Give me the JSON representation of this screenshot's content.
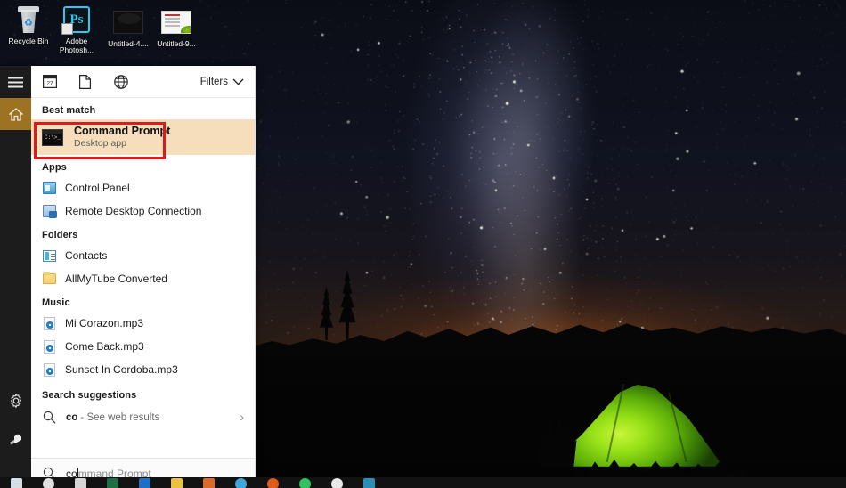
{
  "desktop": {
    "icons": [
      {
        "name": "recycle-bin",
        "label": "Recycle Bin"
      },
      {
        "name": "adobe-photoshop",
        "label": "Adobe Photosh...",
        "badge": "Ps"
      },
      {
        "name": "untitled-4",
        "label": "Untitled-4...."
      },
      {
        "name": "untitled-9",
        "label": "Untitled-9..."
      }
    ]
  },
  "start_panel": {
    "rail": {
      "items": [
        {
          "name": "hamburger-menu",
          "icon": "hamburger-icon",
          "active": false
        },
        {
          "name": "home",
          "icon": "home-icon",
          "active": true
        },
        {
          "name": "settings",
          "icon": "gear-icon",
          "active": false
        },
        {
          "name": "power",
          "icon": "power-icon",
          "active": false
        }
      ],
      "active_color": "#9d7323",
      "background": "#1c1c1c"
    },
    "toolbar": {
      "icons": [
        {
          "name": "apps-icon",
          "title": "Apps"
        },
        {
          "name": "documents-icon",
          "title": "Documents"
        },
        {
          "name": "web-icon",
          "title": "Web"
        }
      ],
      "filters_label": "Filters"
    },
    "sections": [
      {
        "heading": "Best match",
        "type": "best",
        "item": {
          "title": "Command Prompt",
          "subtitle": "Desktop app",
          "icon": "command-prompt-icon",
          "highlight_color": "#f6ddbc",
          "annotation_color": "#e3181b"
        }
      },
      {
        "heading": "Apps",
        "type": "list",
        "items": [
          {
            "label": "Control Panel",
            "icon": "control-panel-icon"
          },
          {
            "label": "Remote Desktop Connection",
            "icon": "remote-desktop-icon"
          }
        ]
      },
      {
        "heading": "Folders",
        "type": "list",
        "items": [
          {
            "label": "Contacts",
            "icon": "contacts-icon"
          },
          {
            "label": "AllMyTube Converted",
            "icon": "folder-icon"
          }
        ]
      },
      {
        "heading": "Music",
        "type": "list",
        "items": [
          {
            "label": "Mi Corazon.mp3",
            "icon": "music-file-icon"
          },
          {
            "label": "Come Back.mp3",
            "icon": "music-file-icon"
          },
          {
            "label": "Sunset In Cordoba.mp3",
            "icon": "music-file-icon"
          }
        ]
      },
      {
        "heading": "Search suggestions",
        "type": "suggestion",
        "item": {
          "query": "co",
          "rest": "- See web results",
          "icon": "search-icon",
          "chevron": "›"
        }
      }
    ],
    "search_box": {
      "icon": "search-icon",
      "typed_text": "co",
      "suggestion_text": "mmand Prompt",
      "full_value": "command Prompt"
    }
  },
  "taskbar": {
    "items": [
      {
        "name": "start-button",
        "color": "#d8dde3"
      },
      {
        "name": "search-button",
        "color": "#e0e0e0"
      },
      {
        "name": "task-view-button",
        "color": "#d6d6d6"
      },
      {
        "name": "excel-app",
        "color": "#1d7044"
      },
      {
        "name": "store-app",
        "color": "#1f6fc4"
      },
      {
        "name": "file-explorer-app",
        "color": "#ecc13c"
      },
      {
        "name": "paint-app",
        "color": "#d96a2b"
      },
      {
        "name": "edge-app",
        "color": "#3ea7dd"
      },
      {
        "name": "firefox-app",
        "color": "#e05a1a"
      },
      {
        "name": "whatsapp-app",
        "color": "#2ec25f"
      },
      {
        "name": "chrome-app",
        "color": "#e8e8e8"
      },
      {
        "name": "photoshop-app",
        "color": "#2a8fb5"
      }
    ]
  },
  "wallpaper": {
    "name": "night-sky-camping-tent",
    "sky_top": "#0b0d16",
    "horizon_glow": "#cd6923",
    "tent_color": "#96e017"
  }
}
